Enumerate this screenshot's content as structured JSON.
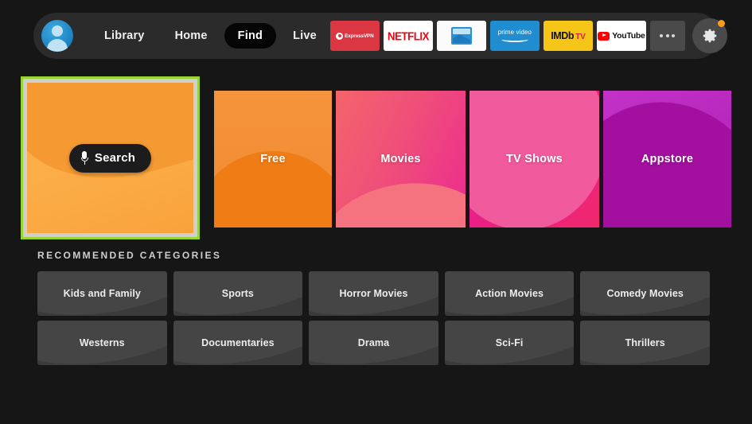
{
  "topbar": {
    "avatar_name": "profile-avatar",
    "nav": [
      {
        "label": "Library",
        "selected": false
      },
      {
        "label": "Home",
        "selected": false
      },
      {
        "label": "Find",
        "selected": true
      },
      {
        "label": "Live",
        "selected": false
      }
    ],
    "apps": [
      {
        "name": "expressvpn",
        "label": "ExpressVPN",
        "bg": "#da3743"
      },
      {
        "name": "netflix",
        "label": "NETFLIX",
        "bg": "#ffffff"
      },
      {
        "name": "photos",
        "label": "Photos",
        "bg": "#fbfbfb"
      },
      {
        "name": "prime-video",
        "label": "prime video",
        "bg": "#1f8dd0"
      },
      {
        "name": "imdb-tv",
        "label": "IMDb",
        "label2": "TV",
        "bg": "#f5c518"
      },
      {
        "name": "youtube",
        "label": "YouTube",
        "bg": "#ffffff"
      }
    ],
    "more_label": "more-options",
    "settings_label": "settings",
    "notification_color": "#f79b1d"
  },
  "hero": {
    "focus_color": "#9ad432",
    "search": {
      "label": "Search",
      "icon": "microphone-icon",
      "focused": true
    },
    "tiles": [
      {
        "label": "Free",
        "color": "#f18a2f"
      },
      {
        "label": "Movies",
        "color": "#ee3d85"
      },
      {
        "label": "TV Shows",
        "color": "#ea1f85"
      },
      {
        "label": "Appstore",
        "color": "#b827bd"
      }
    ]
  },
  "recommended": {
    "heading": "RECOMMENDED CATEGORIES",
    "categories": [
      {
        "label": "Kids and Family"
      },
      {
        "label": "Sports"
      },
      {
        "label": "Horror Movies"
      },
      {
        "label": "Action Movies"
      },
      {
        "label": "Comedy Movies"
      },
      {
        "label": "Westerns"
      },
      {
        "label": "Documentaries"
      },
      {
        "label": "Drama"
      },
      {
        "label": "Sci-Fi"
      },
      {
        "label": "Thrillers"
      }
    ]
  }
}
